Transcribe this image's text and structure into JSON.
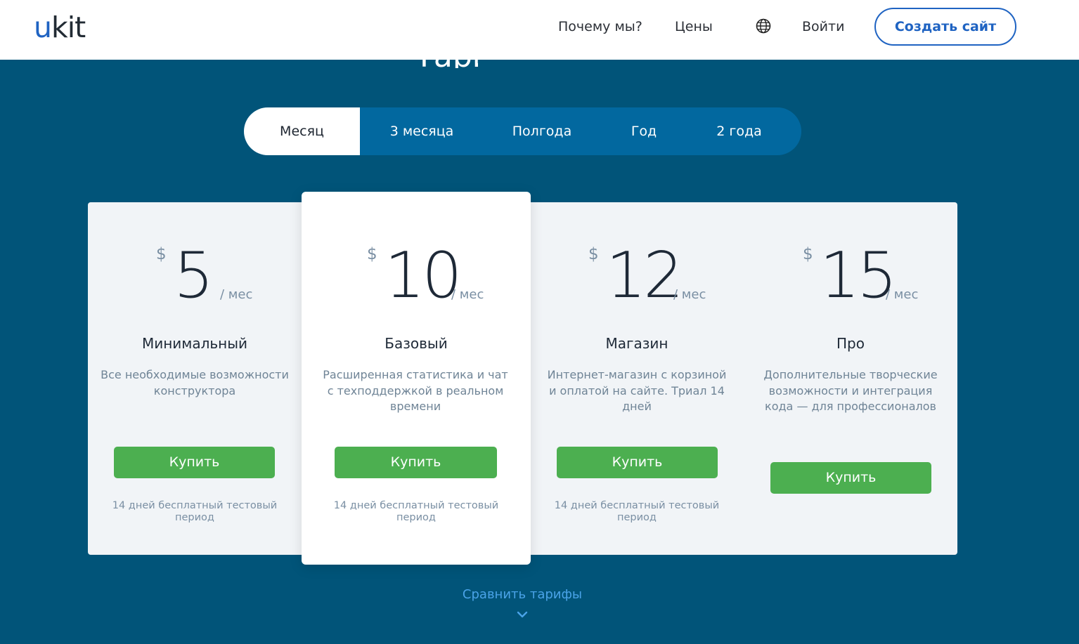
{
  "header": {
    "logo_u": "u",
    "logo_rest": "kit",
    "nav": {
      "why_us": "Почему мы?",
      "prices": "Цены",
      "login": "Войти"
    },
    "globe_icon": "globe-icon",
    "create_site": "Создать сайт"
  },
  "section_title_fragment": "Тарифы",
  "periods": {
    "tabs": [
      "Месяц",
      "3 месяца",
      "Полгода",
      "Год",
      "2 года"
    ],
    "selected": "Месяц"
  },
  "plans": [
    {
      "currency": "$",
      "price": "5",
      "per": "/ мес",
      "name": "Минимальный",
      "description": "Все необходимые возможности конструктора",
      "buy": "Купить",
      "trial": "14 дней бесплатный тестовый период"
    },
    {
      "currency": "$",
      "price": "10",
      "per": "/ мес",
      "name": "Базовый",
      "description": "Расширенная статистика и чат с техподдержкой в реальном времени",
      "buy": "Купить",
      "trial": "14 дней бесплатный тестовый период"
    },
    {
      "currency": "$",
      "price": "12",
      "per": "/ мес",
      "name": "Магазин",
      "description": "Интернет-магазин с корзиной и оплатой на сайте. Триал 14 дней",
      "buy": "Купить",
      "trial": "14 дней бесплатный тестовый период"
    },
    {
      "currency": "$",
      "price": "15",
      "per": "/ мес",
      "name": "Про",
      "description": "Дополнительные творческие возможности и интеграция кода — для профессионалов",
      "buy": "Купить",
      "trial": ""
    }
  ],
  "compare_link": "Сравнить тарифы",
  "colors": {
    "background": "#015479",
    "tab_bar": "#02689f",
    "accent_blue": "#1f63c2",
    "buy_green": "#4caf50",
    "link_blue": "#4aa3e8"
  }
}
